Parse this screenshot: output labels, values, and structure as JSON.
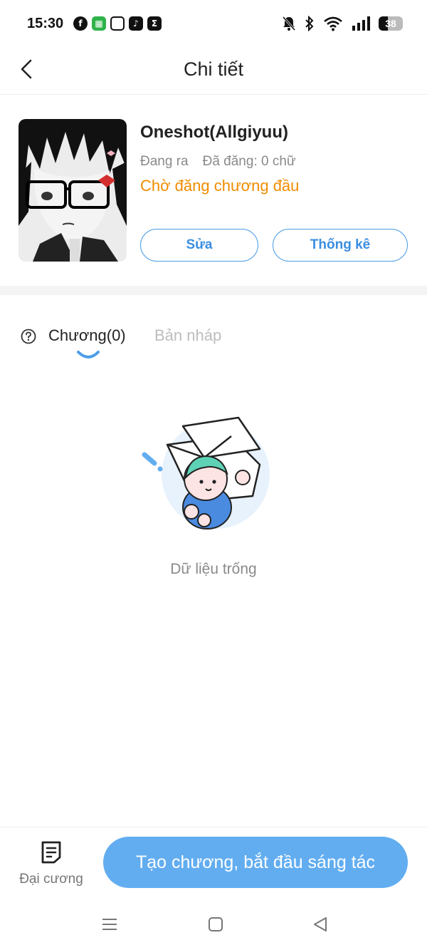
{
  "status_bar": {
    "time": "15:30",
    "apps": [
      "facebook-icon",
      "spotify-icon",
      "instagram-icon",
      "tiktok-icon",
      "sigma-icon"
    ],
    "battery": "38"
  },
  "header": {
    "title": "Chi tiết"
  },
  "story": {
    "title": "Oneshot(Allgiyuu)",
    "status": "Đang ra",
    "posted": "Đã đăng: 0 chữ",
    "pending": "Chờ đăng chương đầu",
    "edit_label": "Sửa",
    "stats_label": "Thống kê"
  },
  "tabs": {
    "chapters": "Chương(0)",
    "drafts": "Bản nháp"
  },
  "empty": {
    "text": "Dữ liệu trống"
  },
  "bottom": {
    "outline_label": "Đại cương",
    "create_label": "Tạo chương, bắt đầu sáng tác"
  },
  "colors": {
    "accent": "#4c9de8",
    "button_fill": "#62adf0",
    "warning": "#f08c00"
  }
}
